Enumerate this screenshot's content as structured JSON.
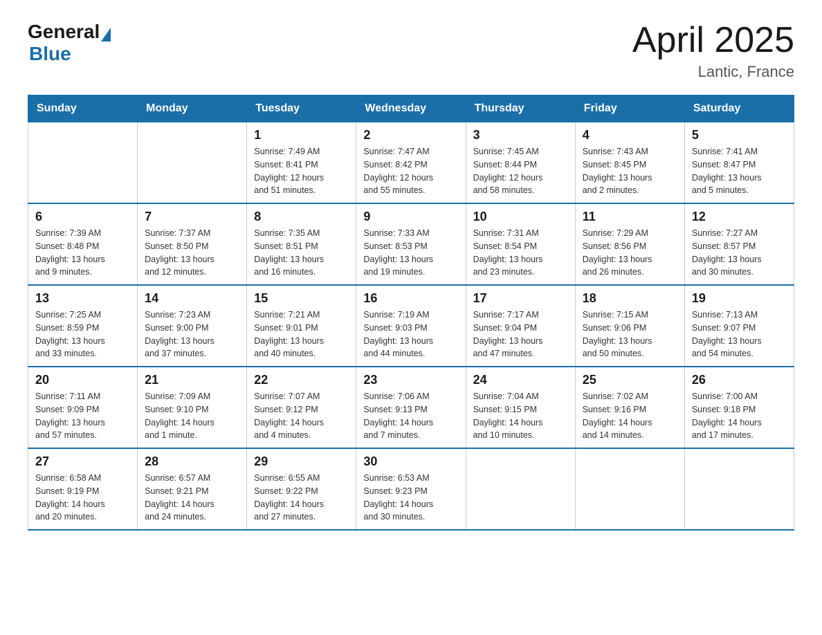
{
  "header": {
    "logo_general": "General",
    "logo_blue": "Blue",
    "title": "April 2025",
    "subtitle": "Lantic, France"
  },
  "days_of_week": [
    "Sunday",
    "Monday",
    "Tuesday",
    "Wednesday",
    "Thursday",
    "Friday",
    "Saturday"
  ],
  "weeks": [
    [
      {
        "day": "",
        "info": ""
      },
      {
        "day": "",
        "info": ""
      },
      {
        "day": "1",
        "info": "Sunrise: 7:49 AM\nSunset: 8:41 PM\nDaylight: 12 hours\nand 51 minutes."
      },
      {
        "day": "2",
        "info": "Sunrise: 7:47 AM\nSunset: 8:42 PM\nDaylight: 12 hours\nand 55 minutes."
      },
      {
        "day": "3",
        "info": "Sunrise: 7:45 AM\nSunset: 8:44 PM\nDaylight: 12 hours\nand 58 minutes."
      },
      {
        "day": "4",
        "info": "Sunrise: 7:43 AM\nSunset: 8:45 PM\nDaylight: 13 hours\nand 2 minutes."
      },
      {
        "day": "5",
        "info": "Sunrise: 7:41 AM\nSunset: 8:47 PM\nDaylight: 13 hours\nand 5 minutes."
      }
    ],
    [
      {
        "day": "6",
        "info": "Sunrise: 7:39 AM\nSunset: 8:48 PM\nDaylight: 13 hours\nand 9 minutes."
      },
      {
        "day": "7",
        "info": "Sunrise: 7:37 AM\nSunset: 8:50 PM\nDaylight: 13 hours\nand 12 minutes."
      },
      {
        "day": "8",
        "info": "Sunrise: 7:35 AM\nSunset: 8:51 PM\nDaylight: 13 hours\nand 16 minutes."
      },
      {
        "day": "9",
        "info": "Sunrise: 7:33 AM\nSunset: 8:53 PM\nDaylight: 13 hours\nand 19 minutes."
      },
      {
        "day": "10",
        "info": "Sunrise: 7:31 AM\nSunset: 8:54 PM\nDaylight: 13 hours\nand 23 minutes."
      },
      {
        "day": "11",
        "info": "Sunrise: 7:29 AM\nSunset: 8:56 PM\nDaylight: 13 hours\nand 26 minutes."
      },
      {
        "day": "12",
        "info": "Sunrise: 7:27 AM\nSunset: 8:57 PM\nDaylight: 13 hours\nand 30 minutes."
      }
    ],
    [
      {
        "day": "13",
        "info": "Sunrise: 7:25 AM\nSunset: 8:59 PM\nDaylight: 13 hours\nand 33 minutes."
      },
      {
        "day": "14",
        "info": "Sunrise: 7:23 AM\nSunset: 9:00 PM\nDaylight: 13 hours\nand 37 minutes."
      },
      {
        "day": "15",
        "info": "Sunrise: 7:21 AM\nSunset: 9:01 PM\nDaylight: 13 hours\nand 40 minutes."
      },
      {
        "day": "16",
        "info": "Sunrise: 7:19 AM\nSunset: 9:03 PM\nDaylight: 13 hours\nand 44 minutes."
      },
      {
        "day": "17",
        "info": "Sunrise: 7:17 AM\nSunset: 9:04 PM\nDaylight: 13 hours\nand 47 minutes."
      },
      {
        "day": "18",
        "info": "Sunrise: 7:15 AM\nSunset: 9:06 PM\nDaylight: 13 hours\nand 50 minutes."
      },
      {
        "day": "19",
        "info": "Sunrise: 7:13 AM\nSunset: 9:07 PM\nDaylight: 13 hours\nand 54 minutes."
      }
    ],
    [
      {
        "day": "20",
        "info": "Sunrise: 7:11 AM\nSunset: 9:09 PM\nDaylight: 13 hours\nand 57 minutes."
      },
      {
        "day": "21",
        "info": "Sunrise: 7:09 AM\nSunset: 9:10 PM\nDaylight: 14 hours\nand 1 minute."
      },
      {
        "day": "22",
        "info": "Sunrise: 7:07 AM\nSunset: 9:12 PM\nDaylight: 14 hours\nand 4 minutes."
      },
      {
        "day": "23",
        "info": "Sunrise: 7:06 AM\nSunset: 9:13 PM\nDaylight: 14 hours\nand 7 minutes."
      },
      {
        "day": "24",
        "info": "Sunrise: 7:04 AM\nSunset: 9:15 PM\nDaylight: 14 hours\nand 10 minutes."
      },
      {
        "day": "25",
        "info": "Sunrise: 7:02 AM\nSunset: 9:16 PM\nDaylight: 14 hours\nand 14 minutes."
      },
      {
        "day": "26",
        "info": "Sunrise: 7:00 AM\nSunset: 9:18 PM\nDaylight: 14 hours\nand 17 minutes."
      }
    ],
    [
      {
        "day": "27",
        "info": "Sunrise: 6:58 AM\nSunset: 9:19 PM\nDaylight: 14 hours\nand 20 minutes."
      },
      {
        "day": "28",
        "info": "Sunrise: 6:57 AM\nSunset: 9:21 PM\nDaylight: 14 hours\nand 24 minutes."
      },
      {
        "day": "29",
        "info": "Sunrise: 6:55 AM\nSunset: 9:22 PM\nDaylight: 14 hours\nand 27 minutes."
      },
      {
        "day": "30",
        "info": "Sunrise: 6:53 AM\nSunset: 9:23 PM\nDaylight: 14 hours\nand 30 minutes."
      },
      {
        "day": "",
        "info": ""
      },
      {
        "day": "",
        "info": ""
      },
      {
        "day": "",
        "info": ""
      }
    ]
  ]
}
